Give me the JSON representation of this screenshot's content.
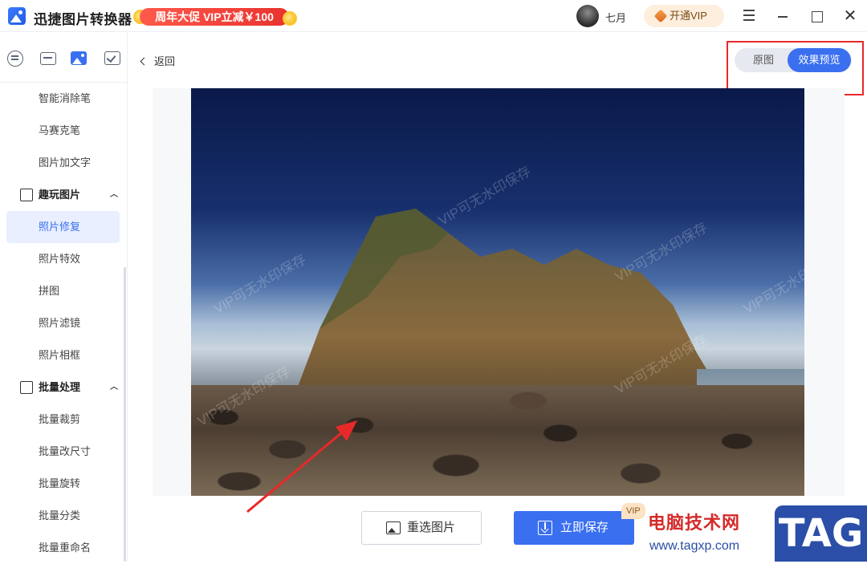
{
  "titlebar": {
    "app_title": "迅捷图片转换器",
    "promo_text": "周年大促 VIP立减￥100",
    "username": "七月",
    "vip_button": "开通VIP"
  },
  "sidebar": {
    "items_top": [
      "智能消除笔",
      "马赛克笔",
      "图片加文字"
    ],
    "group_fun": "趣玩图片",
    "items_fun": [
      "照片修复",
      "照片特效",
      "拼图",
      "照片滤镜",
      "照片相框"
    ],
    "active_item": "照片修复",
    "group_batch": "批量处理",
    "items_batch": [
      "批量裁剪",
      "批量改尺寸",
      "批量旋转",
      "批量分类",
      "批量重命名"
    ]
  },
  "main": {
    "back_label": "返回",
    "toggle": {
      "original": "原图",
      "preview": "效果预览",
      "selected": "效果预览"
    },
    "watermark_text": "VIP可无水印保存",
    "reselect_label": "重选图片",
    "save_label": "立即保存",
    "save_badge": "VIP"
  },
  "overlay": {
    "site_name": "电脑技术网",
    "site_url": "www.tagxp.com",
    "tag_logo": "TAG"
  },
  "colors": {
    "accent": "#3a6ff0",
    "highlight": "#e8292a",
    "promo": "#e8322f"
  }
}
